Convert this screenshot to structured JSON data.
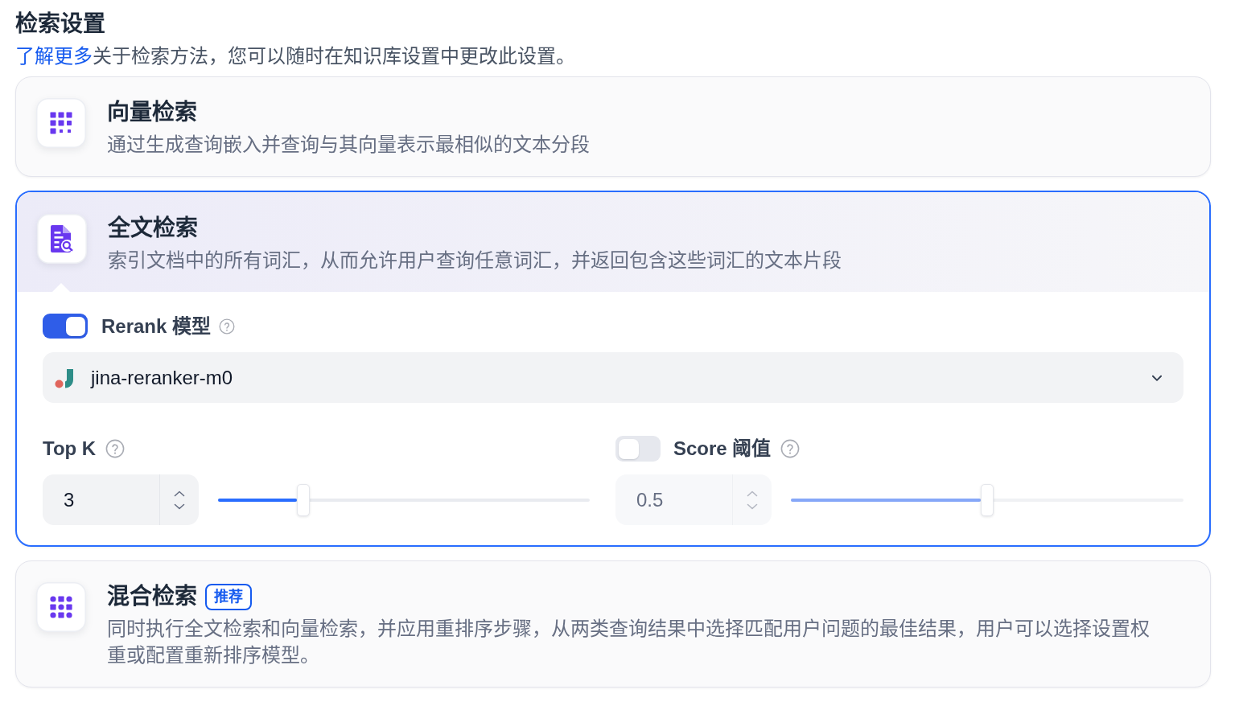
{
  "header": {
    "title": "检索设置",
    "link": "了解更多",
    "text": "关于检索方法，您可以随时在知识库设置中更改此设置。"
  },
  "methods": [
    {
      "kind": "vector",
      "title": "向量检索",
      "description": "通过生成查询嵌入并查询与其向量表示最相似的文本分段",
      "selected": false
    },
    {
      "kind": "full_text",
      "title": "全文检索",
      "description": "索引文档中的所有词汇，从而允许用户查询任意词汇，并返回包含这些词汇的文本片段",
      "selected": true,
      "settings": {
        "rerank": {
          "label": "Rerank 模型",
          "on": true,
          "model": "jina-reranker-m0"
        },
        "top_k": {
          "label": "Top K",
          "value": "3",
          "level": 0.23
        },
        "score_threshold": {
          "label": "Score 阈值",
          "on": false,
          "value": "0.5",
          "level": 0.5
        }
      }
    },
    {
      "kind": "hybrid",
      "title": "混合检索",
      "badge": "推荐",
      "description": "同时执行全文检索和向量检索，并应用重排序步骤，从两类查询结果中选择匹配用户问题的最佳结果，用户可以选择设置权重或配置重新排序模型。",
      "selected": false
    }
  ]
}
